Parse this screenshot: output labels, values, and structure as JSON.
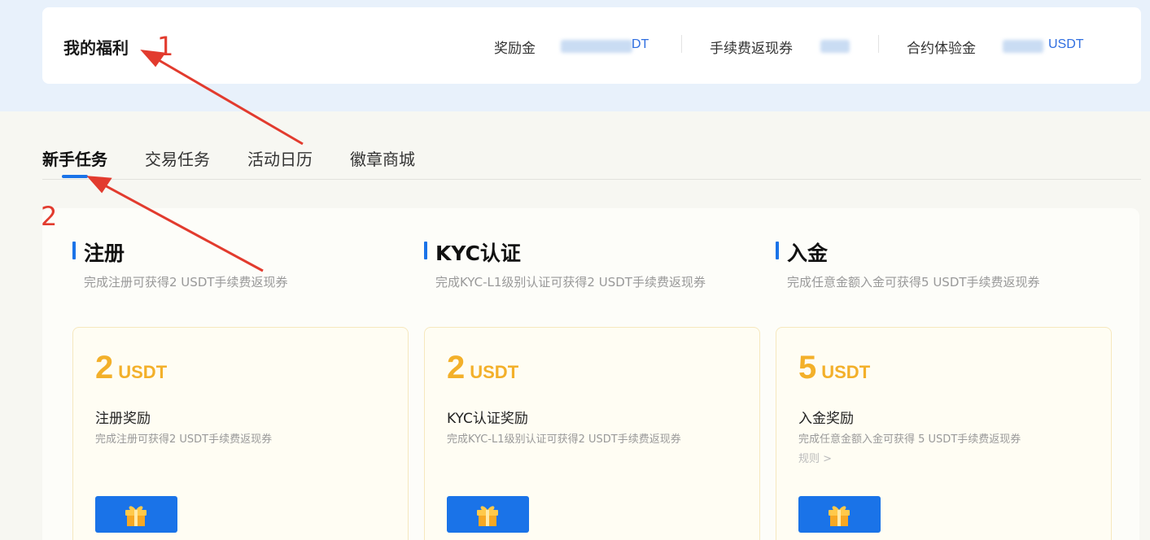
{
  "header": {
    "title": "我的福利",
    "stats": [
      {
        "label": "奖励金",
        "value": "DT"
      },
      {
        "label": "手续费返现券",
        "value": ""
      },
      {
        "label": "合约体验金",
        "value": "USDT"
      }
    ]
  },
  "tabs": [
    {
      "label": "新手任务",
      "active": true
    },
    {
      "label": "交易任务",
      "active": false
    },
    {
      "label": "活动日历",
      "active": false
    },
    {
      "label": "徽章商城",
      "active": false
    }
  ],
  "sections": [
    {
      "title": "注册",
      "desc": "完成注册可获得2 USDT手续费返现券"
    },
    {
      "title": "KYC认证",
      "desc": "完成KYC-L1级别认证可获得2 USDT手续费返现券"
    },
    {
      "title": "入金",
      "desc": "完成任意金额入金可获得5 USDT手续费返现券"
    }
  ],
  "cards": [
    {
      "amount": "2",
      "unit": "USDT",
      "name": "注册奖励",
      "desc": "完成注册可获得2 USDT手续费返现券",
      "rule": ""
    },
    {
      "amount": "2",
      "unit": "USDT",
      "name": "KYC认证奖励",
      "desc": "完成KYC-L1级别认证可获得2 USDT手续费返现券",
      "rule": ""
    },
    {
      "amount": "5",
      "unit": "USDT",
      "name": "入金奖励",
      "desc": "完成任意金额入金可获得 5 USDT手续费返现券",
      "rule": "规则 >"
    }
  ],
  "annotations": [
    "1",
    "2"
  ],
  "colors": {
    "accent": "#1a73e8",
    "gold": "#f3b02a",
    "annotation": "#e23b2e"
  },
  "icons": [
    "gift-icon"
  ]
}
